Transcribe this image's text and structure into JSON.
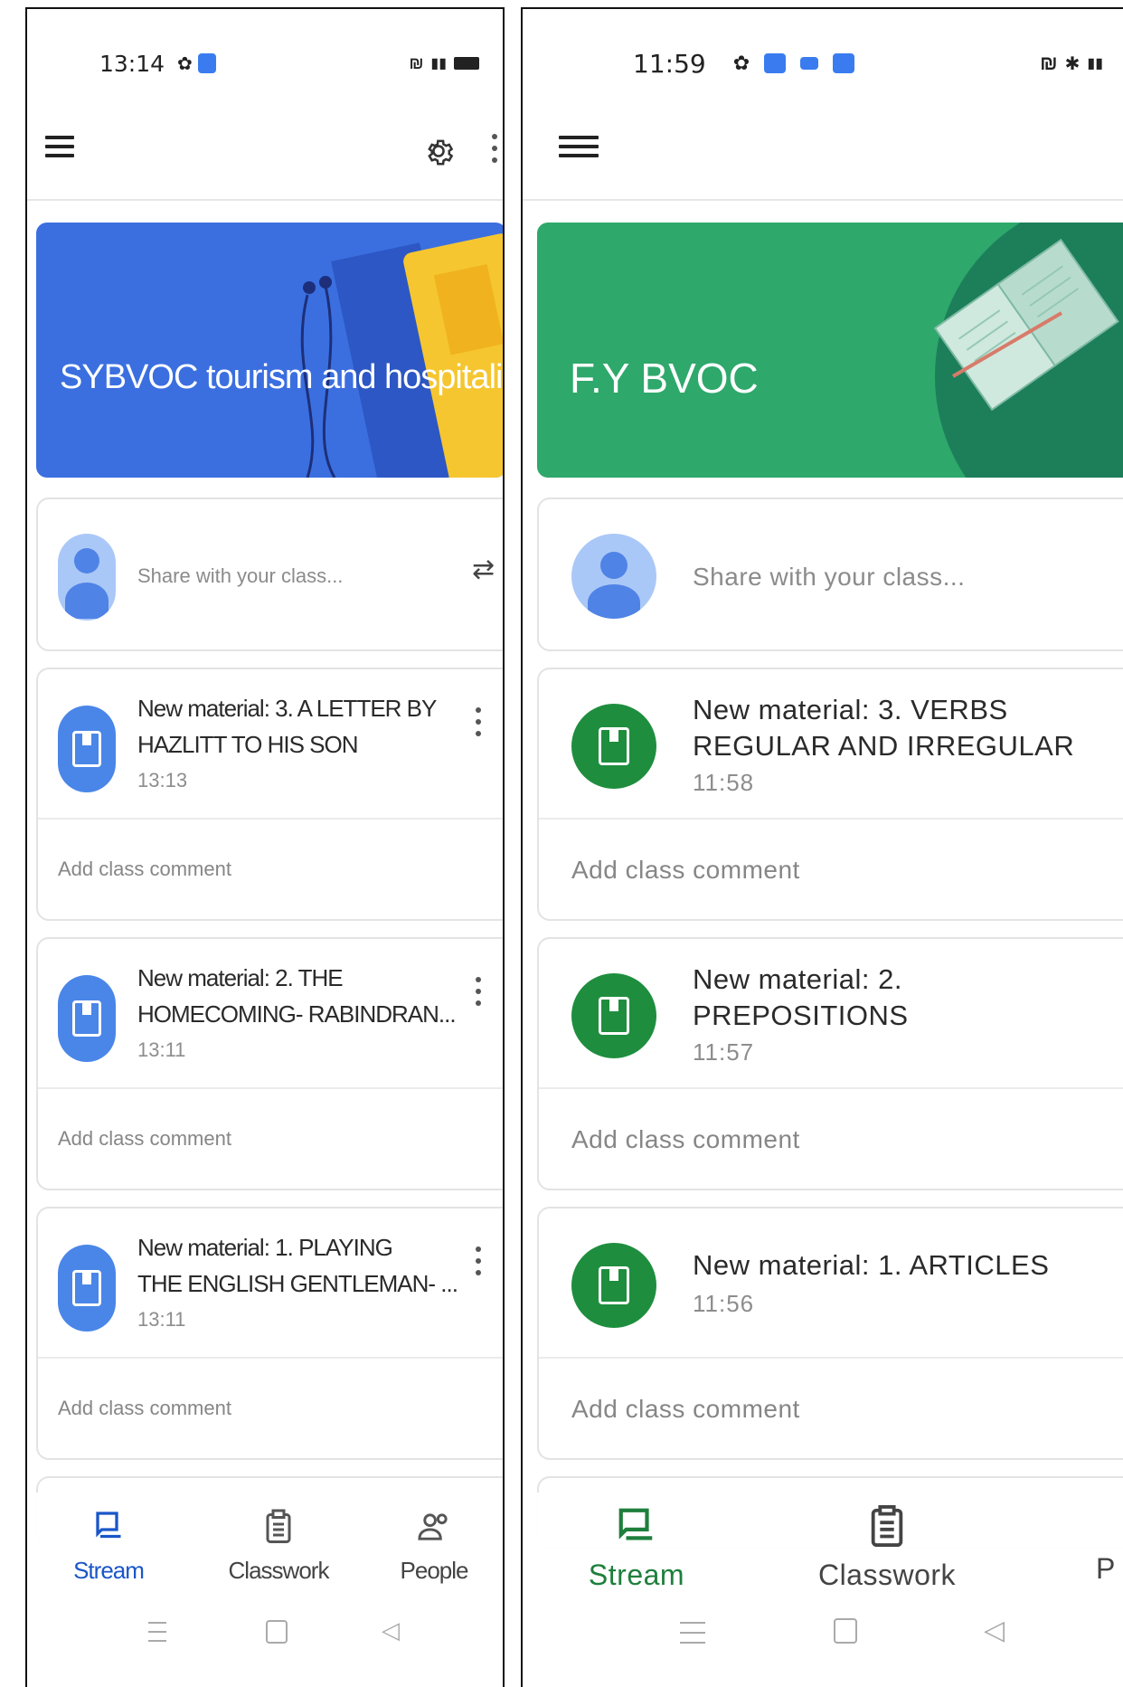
{
  "left": {
    "status": {
      "time": "13:14"
    },
    "class_title": "SYBVOC tourism and hospitali...",
    "share_placeholder": "Share with your class...",
    "posts": [
      {
        "title_line1": "New material: 3. A LETTER BY",
        "title_line2": "HAZLITT TO HIS SON",
        "time": "13:13",
        "comment": "Add class comment"
      },
      {
        "title_line1": "New material: 2. THE",
        "title_line2": "HOMECOMING- RABINDRAN...",
        "time": "13:11",
        "comment": "Add class comment"
      },
      {
        "title_line1": "New material: 1. PLAYING",
        "title_line2": "THE ENGLISH GENTLEMAN- ...",
        "time": "13:11",
        "comment": "Add class comment"
      }
    ],
    "nav": {
      "stream": "Stream",
      "classwork": "Classwork",
      "people": "People"
    },
    "colors": {
      "banner": "#3b6fe0",
      "accent": "#1a56c9",
      "icon": "#4a86e8"
    }
  },
  "right": {
    "status": {
      "time": "11:59"
    },
    "class_title": "F.Y BVOC",
    "share_placeholder": "Share with your class...",
    "posts": [
      {
        "title_line1": "New material: 3. VERBS",
        "title_line2": "REGULAR AND IRREGULAR",
        "time": "11:58",
        "comment": "Add class comment"
      },
      {
        "title_line1": "New material: 2.",
        "title_line2": "PREPOSITIONS",
        "time": "11:57",
        "comment": "Add class comment"
      },
      {
        "title_line1": "New material: 1. ARTICLES",
        "title_line2": "",
        "time": "11:56",
        "comment": "Add class comment"
      }
    ],
    "nav": {
      "stream": "Stream",
      "classwork": "Classwork",
      "people_partial": "P"
    },
    "colors": {
      "banner": "#2ea86b",
      "accent": "#1e7f3c",
      "icon": "#1e8e3e"
    }
  }
}
